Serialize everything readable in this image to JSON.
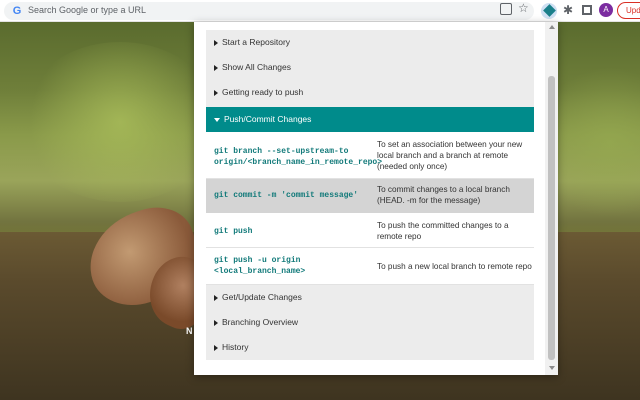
{
  "browser": {
    "omnibox_placeholder": "Search Google or type a URL",
    "google_icon": "G",
    "avatar_initial": "A",
    "update_label": "Update"
  },
  "background": {
    "partial_text": "N"
  },
  "popup": {
    "sections_top": [
      {
        "label": "Start a Repository",
        "icon": "caret-right-icon"
      },
      {
        "label": "Show All Changes",
        "icon": "caret-right-icon"
      },
      {
        "label": "Getting ready to push",
        "icon": "caret-right-icon"
      }
    ],
    "open_section": {
      "label": "Push/Commit Changes",
      "icon": "caret-down-icon"
    },
    "commands": [
      {
        "command": "git branch --set-upstream-to origin/<branch_name_in_remote_repo>",
        "description": "To set an association between your new local branch and a branch at remote (needed only once)"
      },
      {
        "command": "git commit -m 'commit message'",
        "description": "To commit changes to a local branch (HEAD. -m for the message)"
      },
      {
        "command": "git push",
        "description": "To push the committed changes to a remote repo"
      },
      {
        "command": "git push -u origin <local_branch_name>",
        "description": "To push a new local branch to remote repo"
      }
    ],
    "sections_bottom": [
      {
        "label": "Get/Update Changes",
        "icon": "caret-right-icon"
      },
      {
        "label": "Branching Overview",
        "icon": "caret-right-icon"
      },
      {
        "label": "History",
        "icon": "caret-right-icon"
      }
    ]
  },
  "colors": {
    "accent": "#008b8b",
    "command_text": "#127a7a",
    "update_red": "#d93025",
    "avatar": "#7b2ca0"
  }
}
